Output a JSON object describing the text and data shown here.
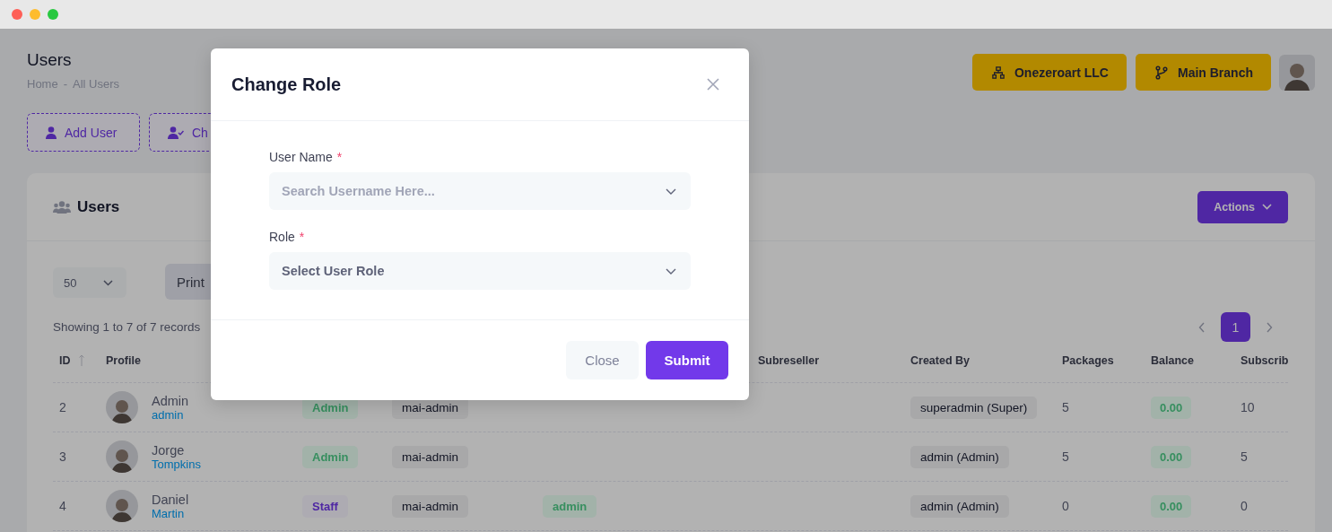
{
  "page": {
    "title": "Users",
    "breadcrumb": [
      "Home",
      "All Users"
    ],
    "breadcrumb_separator": "-"
  },
  "header_buttons": [
    {
      "label": "Onezeroart LLC",
      "kind": "company"
    },
    {
      "label": "Main Branch",
      "kind": "branch"
    }
  ],
  "toolbar": [
    {
      "label": "Add User",
      "kind": "add"
    },
    {
      "label": "Ch",
      "kind": "change"
    }
  ],
  "card": {
    "title": "Users",
    "actions": "Actions",
    "page_size": "50",
    "print": "Print",
    "summary": "Showing 1 to 7 of 7 records",
    "pages": [
      {
        "label": "1",
        "selected": true
      }
    ]
  },
  "table": {
    "columns": [
      {
        "label": "ID",
        "sortable": true
      },
      {
        "label": "Profile",
        "sortable": false
      },
      {},
      {},
      {},
      {
        "label": "Subreseller",
        "sortable": false
      },
      {
        "label": "Created By",
        "sortable": false
      },
      {
        "label": "Packages",
        "sortable": false
      },
      {
        "label": "Balance",
        "sortable": false
      },
      {
        "label": "Subscrib",
        "sortable": false
      }
    ],
    "rows": [
      {
        "id": "2",
        "first_name": "Admin",
        "last_name": "admin",
        "role": {
          "text": "Admin",
          "kind": "admin"
        },
        "parent": "mai-admin",
        "created_by": "superadmin (Super)",
        "packages": "5",
        "balance": "0.00",
        "subscriptions": "10"
      },
      {
        "id": "3",
        "first_name": "Jorge",
        "last_name": "Tompkins",
        "role": {
          "text": "Admin",
          "kind": "admin"
        },
        "parent": "mai-admin",
        "created_by": "admin (Admin)",
        "packages": "5",
        "balance": "0.00",
        "subscriptions": "5"
      },
      {
        "id": "4",
        "first_name": "Daniel",
        "last_name": "Martin",
        "role": {
          "text": "Staff",
          "kind": "staff"
        },
        "parent": "mai-admin",
        "column_5": "admin",
        "created_by": "admin (Admin)",
        "packages": "0",
        "balance": "0.00",
        "subscriptions": "0"
      }
    ]
  },
  "modal": {
    "title": "Change Role",
    "fields": [
      {
        "label": "User Name",
        "required_mark": "*",
        "placeholder": "Search Username Here..."
      },
      {
        "label": "Role",
        "required_mark": "*",
        "value": "Select User Role"
      }
    ],
    "buttons": [
      {
        "label": "Close",
        "kind": "secondary"
      },
      {
        "label": "Submit",
        "kind": "primary"
      }
    ]
  }
}
